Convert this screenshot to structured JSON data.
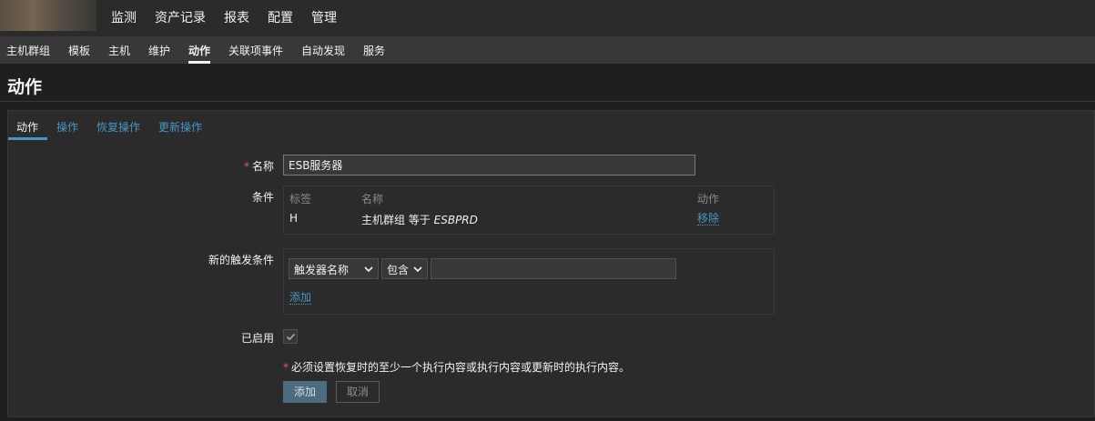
{
  "top_nav": {
    "items": [
      "监测",
      "资产记录",
      "报表",
      "配置",
      "管理"
    ],
    "active": "配置"
  },
  "sub_nav": {
    "items": [
      "主机群组",
      "模板",
      "主机",
      "维护",
      "动作",
      "关联项事件",
      "自动发现",
      "服务"
    ],
    "active": "动作"
  },
  "page": {
    "title": "动作"
  },
  "tabs": {
    "items": [
      "动作",
      "操作",
      "恢复操作",
      "更新操作"
    ],
    "active": "动作"
  },
  "form": {
    "name_label": "名称",
    "name_value": "ESB服务器",
    "conditions_label": "条件",
    "conditions_table": {
      "headers": [
        "标签",
        "名称",
        "动作"
      ],
      "rows": [
        {
          "tag": "H",
          "name_prefix": "主机群组 等于 ",
          "name_value": "ESBPRD",
          "action": "移除"
        }
      ]
    },
    "new_condition_label": "新的触发条件",
    "condition_type": "触发器名称",
    "operator": "包含",
    "condition_value": "",
    "add_condition_link": "添加",
    "enabled_label": "已启用",
    "enabled": true,
    "required_note": "必须设置恢复时的至少一个执行内容或执行内容或更新时的执行内容。",
    "add_button": "添加",
    "cancel_button": "取消"
  },
  "colors": {
    "background": "#1f1f1f",
    "panel": "#2b2b2b",
    "link": "#4796c4",
    "required": "#e45959",
    "primary_button": "#4b6b7e"
  }
}
